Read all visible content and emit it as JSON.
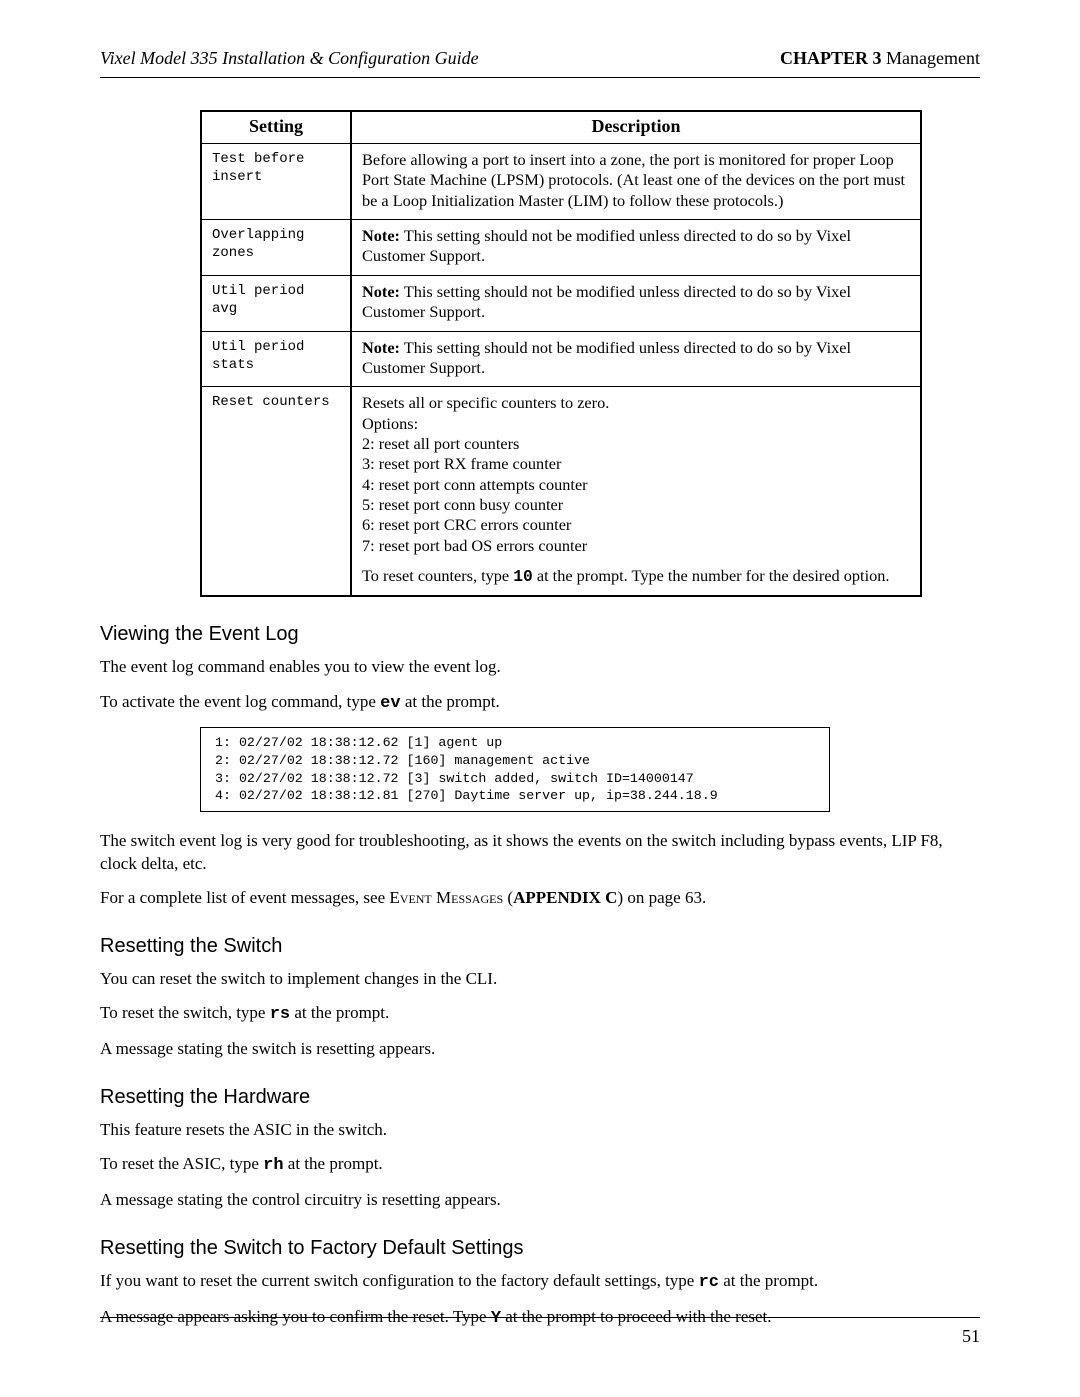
{
  "header": {
    "doc_title": "Vixel Model 335 Installation & Configuration Guide",
    "chapter_label": "CHAPTER 3",
    "chapter_title": " Management"
  },
  "table": {
    "head": {
      "setting": "Setting",
      "description": "Description"
    },
    "rows": [
      {
        "setting": "Test before\ninsert",
        "desc": "Before allowing a port to insert into a zone, the port is monitored for proper Loop Port State Machine (LPSM) protocols. (At least one of the devices on the port must be a Loop Initialization Master (LIM) to follow these protocols.)"
      },
      {
        "setting": "Overlapping\nzones",
        "desc_prefix": "Note:",
        "desc": " This setting should not be modified unless directed to do so by Vixel Customer Support."
      },
      {
        "setting": "Util period\navg",
        "desc_prefix": "Note:",
        "desc": " This setting should not be modified unless directed to do so by Vixel Customer Support."
      },
      {
        "setting": "Util period\nstats",
        "desc_prefix": "Note:",
        "desc": " This setting should not be modified unless directed to do so by Vixel Customer Support."
      },
      {
        "setting": "Reset counters",
        "desc_lines": [
          "Resets all or specific counters to zero.",
          "Options:",
          "2: reset all port counters",
          "3: reset port RX frame counter",
          "4: reset port conn attempts counter",
          "5: reset port conn busy counter",
          "6: reset port CRC errors counter",
          "7: reset port bad OS errors counter"
        ],
        "desc_tail_pre": "To reset counters, type ",
        "desc_tail_code": "10",
        "desc_tail_post": " at the prompt. Type the number for the desired option."
      }
    ]
  },
  "sections": {
    "eventlog": {
      "heading": "Viewing the Event Log",
      "p1": "The event log command enables you to view the event log.",
      "p2_pre": "To activate the event log command, type ",
      "p2_code": "ev",
      "p2_post": " at the prompt.",
      "log": "1: 02/27/02 18:38:12.62 [1] agent up\n2: 02/27/02 18:38:12.72 [160] management active\n3: 02/27/02 18:38:12.72 [3] switch added, switch ID=14000147\n4: 02/27/02 18:38:12.81 [270] Daytime server up, ip=38.244.18.9",
      "p3": "The switch event log is very good for troubleshooting, as it shows the events on the switch including bypass events, LIP F8, clock delta, etc.",
      "p4_pre": "For a complete list of event messages, see ",
      "p4_sc": "Event Messages",
      "p4_mid": " (",
      "p4_bold": "APPENDIX C",
      "p4_post": ") on page 63."
    },
    "resetswitch": {
      "heading": "Resetting the Switch",
      "p1": "You can reset the switch to implement changes in the CLI.",
      "p2_pre": "To reset the switch, type ",
      "p2_code": "rs",
      "p2_post": " at the prompt.",
      "p3": "A message stating the switch is resetting appears."
    },
    "resethw": {
      "heading": "Resetting the Hardware",
      "p1": "This feature resets the ASIC in the switch.",
      "p2_pre": "To reset the ASIC, type ",
      "p2_code": "rh",
      "p2_post": " at the prompt.",
      "p3": "A message stating the control circuitry is resetting appears."
    },
    "factory": {
      "heading": "Resetting the Switch to Factory Default Settings",
      "p1_pre": "If you want to reset the current switch configuration to the factory default settings, type ",
      "p1_code": "rc",
      "p1_post": " at the prompt.",
      "p2_pre": "A message appears asking you to confirm the reset. Type ",
      "p2_code": "Y",
      "p2_post": " at the prompt to proceed with the reset."
    }
  },
  "footer": {
    "page_number": "51"
  }
}
